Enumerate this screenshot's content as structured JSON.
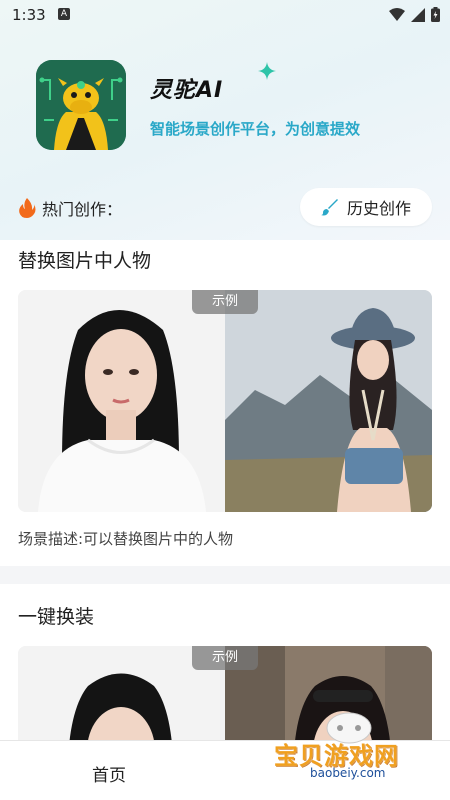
{
  "status_bar": {
    "time": "1:33",
    "notification_glyph": "A"
  },
  "app": {
    "name": "灵驼AI",
    "tagline": "智能场景创作平台，为创意提效",
    "logo_icon": "camel-logo-icon"
  },
  "hot": {
    "label": "热门创作：",
    "icon": "fire-icon"
  },
  "history_button": {
    "label": "历史创作",
    "icon": "brush-icon"
  },
  "cards": [
    {
      "title": "替换图片中人物",
      "badge": "示例",
      "description": "场景描述:可以替换图片中的人物"
    },
    {
      "title": "一键换装",
      "badge": "示例"
    }
  ],
  "bottom_nav": {
    "home_label": "首页"
  },
  "watermark": {
    "title": "宝贝游戏网",
    "url": "baobeiy.com"
  },
  "colors": {
    "accent": "#2aa8c8",
    "icon_bg": "#1f6b4f",
    "camel": "#f2c21a",
    "badge_bg": "#7a7a7a"
  }
}
